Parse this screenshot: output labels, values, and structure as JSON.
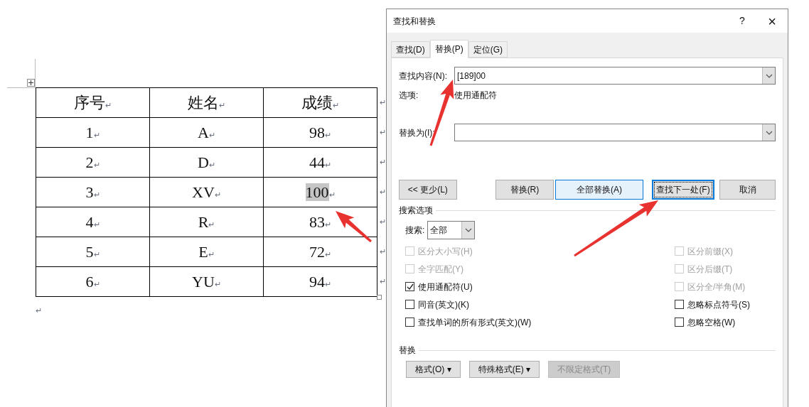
{
  "document": {
    "table": {
      "columns": [
        {
          "text": "序号",
          "mark": "↵"
        },
        {
          "text": "姓名",
          "mark": "↵"
        },
        {
          "text": "成绩",
          "mark": "↵"
        }
      ],
      "header_end_mark": "↵",
      "rows": [
        {
          "cells": [
            {
              "text": "1",
              "mark": "↵",
              "selected": false
            },
            {
              "text": "A",
              "mark": "↵",
              "selected": false
            },
            {
              "text": "98",
              "mark": "↵",
              "selected": false
            }
          ],
          "end_mark": "↵"
        },
        {
          "cells": [
            {
              "text": "2",
              "mark": "↵",
              "selected": false
            },
            {
              "text": "D",
              "mark": "↵",
              "selected": false
            },
            {
              "text": "44",
              "mark": "↵",
              "selected": false
            }
          ],
          "end_mark": "↵"
        },
        {
          "cells": [
            {
              "text": "3",
              "mark": "↵",
              "selected": false
            },
            {
              "text": "XV",
              "mark": "↵",
              "selected": false
            },
            {
              "text": "100",
              "mark": "↵",
              "selected": true
            }
          ],
          "end_mark": "↵"
        },
        {
          "cells": [
            {
              "text": "4",
              "mark": "↵",
              "selected": false
            },
            {
              "text": "R",
              "mark": "↵",
              "selected": false
            },
            {
              "text": "83",
              "mark": "↵",
              "selected": false
            }
          ],
          "end_mark": "↵"
        },
        {
          "cells": [
            {
              "text": "5",
              "mark": "↵",
              "selected": false
            },
            {
              "text": "E",
              "mark": "↵",
              "selected": false
            },
            {
              "text": "72",
              "mark": "↵",
              "selected": false
            }
          ],
          "end_mark": "↵"
        },
        {
          "cells": [
            {
              "text": "6",
              "mark": "↵",
              "selected": false
            },
            {
              "text": "YU",
              "mark": "↵",
              "selected": false
            },
            {
              "text": "94",
              "mark": "↵",
              "selected": false
            }
          ],
          "end_mark": "↵"
        }
      ]
    },
    "paragraph_mark": "↵"
  },
  "dialog": {
    "title": "查找和替换",
    "help": "?",
    "close": "×",
    "tabs": [
      {
        "label": "查找(D)",
        "selected": false
      },
      {
        "label": "替换(P)",
        "selected": true
      },
      {
        "label": "定位(G)",
        "selected": false
      }
    ],
    "find": {
      "label": "查找内容(N):",
      "value": "[189]00"
    },
    "options": {
      "label": "选项:",
      "value": "使用通配符"
    },
    "replace": {
      "label": "替换为(I):"
    },
    "buttons": [
      {
        "label": "<< 更少(L)",
        "kind": "plain"
      },
      {
        "label": "替换(R)",
        "kind": "plain"
      },
      {
        "label": "全部替换(A)",
        "kind": "hover"
      },
      {
        "label": "查找下一处(F)",
        "kind": "focused"
      },
      {
        "label": "取消",
        "kind": "plain"
      }
    ],
    "search_options": {
      "title": "搜索选项",
      "search_label": "搜索:",
      "search_value": "全部",
      "left": [
        {
          "label": "区分大小写(H)",
          "checked": false,
          "disabled": true
        },
        {
          "label": "全字匹配(Y)",
          "checked": false,
          "disabled": true
        },
        {
          "label": "使用通配符(U)",
          "checked": true,
          "disabled": false
        },
        {
          "label": "同音(英文)(K)",
          "checked": false,
          "disabled": false
        },
        {
          "label": "查找单词的所有形式(英文)(W)",
          "checked": false,
          "disabled": false
        }
      ],
      "right": [
        {
          "label": "区分前缀(X)",
          "checked": false,
          "disabled": true
        },
        {
          "label": "区分后缀(T)",
          "checked": false,
          "disabled": true
        },
        {
          "label": "区分全/半角(M)",
          "checked": false,
          "disabled": true
        },
        {
          "label": "忽略标点符号(S)",
          "checked": false,
          "disabled": false
        },
        {
          "label": "忽略空格(W)",
          "checked": false,
          "disabled": false
        }
      ]
    },
    "replace_section": {
      "title": "替换",
      "buttons": [
        {
          "label": "格式(O) ▾",
          "disabled": false
        },
        {
          "label": "特殊格式(E) ▾",
          "disabled": false
        },
        {
          "label": "不限定格式(T)",
          "disabled": true
        }
      ]
    }
  }
}
